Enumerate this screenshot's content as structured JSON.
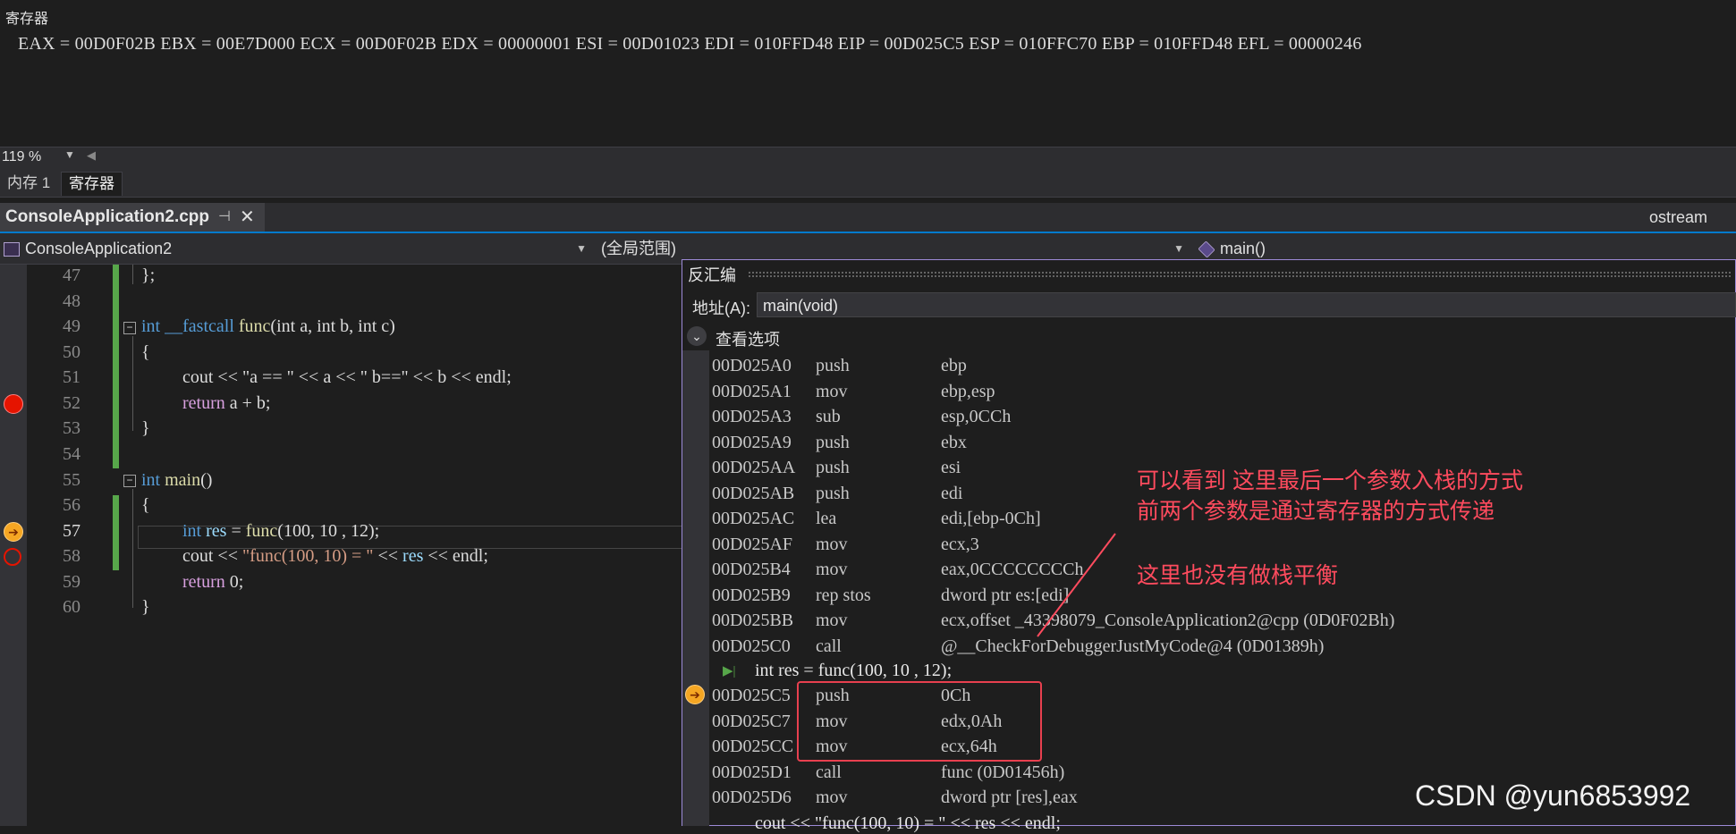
{
  "registers": {
    "title": "寄存器",
    "line": "EAX = 00D0F02B EBX = 00E7D000 ECX = 00D0F02B EDX = 00000001 ESI = 00D01023 EDI = 010FFD48 EIP = 00D025C5 ESP = 010FFC70 EBP = 010FFD48 EFL = 00000246",
    "zoom": "119 %"
  },
  "tool_tabs": {
    "memory": "内存 1",
    "registers": "寄存器"
  },
  "doc_tab": {
    "label": "ConsoleApplication2.cpp",
    "right_tab": "ostream"
  },
  "navbar": {
    "project": "ConsoleApplication2",
    "scope": "(全局范围)",
    "member": "main()"
  },
  "code": {
    "line_numbers": [
      "47",
      "48",
      "49",
      "50",
      "51",
      "52",
      "53",
      "54",
      "55",
      "56",
      "57",
      "58",
      "59",
      "60"
    ],
    "lines": {
      "l47": "};",
      "l49_kw1": "int",
      "l49_kw2": "__fastcall",
      "l49_fn": "func",
      "l49_rest": "(int a, int b, int c)",
      "l50": "{",
      "l51": "cout << \"a == \" << a << \" b==\" << b << endl;",
      "l52_kw": "return",
      "l52_rest": " a + b;",
      "l53": "}",
      "l55_kw": "int",
      "l55_fn": "main",
      "l55_rest": "()",
      "l56": "{",
      "l57_kw": "int",
      "l57_var": "res",
      "l57_rest1": " = ",
      "l57_fn": "func",
      "l57_rest2": "(100, 10 , 12);",
      "l58_a": "cout << ",
      "l58_str": "\"func(100, 10) = \"",
      "l58_b": " << ",
      "l58_var": "res",
      "l58_c": " << endl;",
      "l59_kw": "return",
      "l59_rest": " 0;",
      "l60": "}"
    }
  },
  "disasm": {
    "title": "反汇编",
    "address_label": "地址(A):",
    "address_value": "main(void)",
    "view_options": "查看选项",
    "rows": [
      {
        "addr": "00D025A0",
        "mn": "push",
        "op": "ebp"
      },
      {
        "addr": "00D025A1",
        "mn": "mov",
        "op": "ebp,esp"
      },
      {
        "addr": "00D025A3",
        "mn": "sub",
        "op": "esp,0CCh"
      },
      {
        "addr": "00D025A9",
        "mn": "push",
        "op": "ebx"
      },
      {
        "addr": "00D025AA",
        "mn": "push",
        "op": "esi"
      },
      {
        "addr": "00D025AB",
        "mn": "push",
        "op": "edi"
      },
      {
        "addr": "00D025AC",
        "mn": "lea",
        "op": "edi,[ebp-0Ch]"
      },
      {
        "addr": "00D025AF",
        "mn": "mov",
        "op": "ecx,3"
      },
      {
        "addr": "00D025B4",
        "mn": "mov",
        "op": "eax,0CCCCCCCCh"
      },
      {
        "addr": "00D025B9",
        "mn": "rep stos",
        "op": "dword ptr es:[edi]"
      },
      {
        "addr": "00D025BB",
        "mn": "mov",
        "op": "ecx,offset _43398079_ConsoleApplication2@cpp (0D0F02Bh)"
      },
      {
        "addr": "00D025C0",
        "mn": "call",
        "op": "@__CheckForDebuggerJustMyCode@4 (0D01389h)"
      }
    ],
    "source_line": "int res = func(100, 10 , 12);",
    "rows2": [
      {
        "addr": "00D025C5",
        "mn": "push",
        "op": "0Ch"
      },
      {
        "addr": "00D025C7",
        "mn": "mov",
        "op": "edx,0Ah"
      },
      {
        "addr": "00D025CC",
        "mn": "mov",
        "op": "ecx,64h"
      },
      {
        "addr": "00D025D1",
        "mn": "call",
        "op": "func (0D01456h)"
      },
      {
        "addr": "00D025D6",
        "mn": "mov",
        "op": "dword ptr [res],eax"
      }
    ],
    "source_line2": "cout << \"func(100, 10) = \" << res << endl;"
  },
  "annotation": {
    "line1": "可以看到 这里最后一个参数入栈的方式",
    "line2": "前两个参数是通过寄存器的方式传递",
    "line3": "这里也没有做栈平衡"
  },
  "watermark": "CSDN @yun6853992",
  "colors": {
    "accent": "#007acc",
    "annotation": "#ff4b5e",
    "breakpoint": "#e51400"
  }
}
